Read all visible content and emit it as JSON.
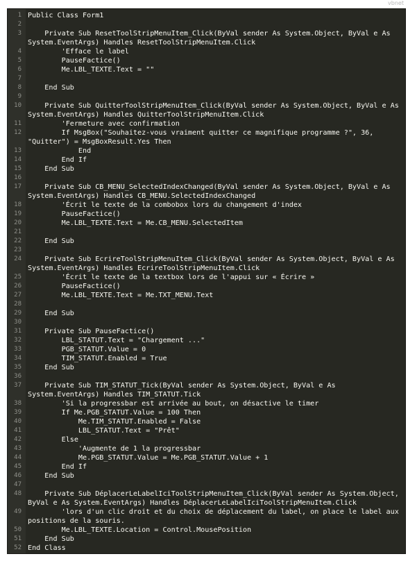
{
  "lang_label": "vbnet",
  "lines": [
    {
      "n": "1",
      "text": "Public Class Form1"
    },
    {
      "n": "2",
      "text": ""
    },
    {
      "n": "3",
      "text": "    Private Sub ResetToolStripMenuItem_Click(ByVal sender As System.Object, ByVal e As"
    },
    {
      "n": "",
      "text": "System.EventArgs) Handles ResetToolStripMenuItem.Click"
    },
    {
      "n": "4",
      "text": "        'Efface le label"
    },
    {
      "n": "5",
      "text": "        PauseFactice()"
    },
    {
      "n": "6",
      "text": "        Me.LBL_TEXTE.Text = \"\""
    },
    {
      "n": "7",
      "text": ""
    },
    {
      "n": "8",
      "text": "    End Sub"
    },
    {
      "n": "9",
      "text": ""
    },
    {
      "n": "10",
      "text": "    Private Sub QuitterToolStripMenuItem_Click(ByVal sender As System.Object, ByVal e As"
    },
    {
      "n": "",
      "text": "System.EventArgs) Handles QuitterToolStripMenuItem.Click"
    },
    {
      "n": "11",
      "text": "        'Fermeture avec confirmation"
    },
    {
      "n": "12",
      "text": "        If MsgBox(\"Souhaitez-vous vraiment quitter ce magnifique programme ?\", 36,"
    },
    {
      "n": "",
      "text": "\"Quitter\") = MsgBoxResult.Yes Then"
    },
    {
      "n": "13",
      "text": "            End"
    },
    {
      "n": "14",
      "text": "        End If"
    },
    {
      "n": "15",
      "text": "    End Sub"
    },
    {
      "n": "16",
      "text": ""
    },
    {
      "n": "17",
      "text": "    Private Sub CB_MENU_SelectedIndexChanged(ByVal sender As System.Object, ByVal e As"
    },
    {
      "n": "",
      "text": "System.EventArgs) Handles CB_MENU.SelectedIndexChanged"
    },
    {
      "n": "18",
      "text": "        'Écrit le texte de la combobox lors du changement d'index"
    },
    {
      "n": "19",
      "text": "        PauseFactice()"
    },
    {
      "n": "20",
      "text": "        Me.LBL_TEXTE.Text = Me.CB_MENU.SelectedItem"
    },
    {
      "n": "21",
      "text": ""
    },
    {
      "n": "22",
      "text": "    End Sub"
    },
    {
      "n": "23",
      "text": ""
    },
    {
      "n": "24",
      "text": "    Private Sub EcrireToolStripMenuItem_Click(ByVal sender As System.Object, ByVal e As"
    },
    {
      "n": "",
      "text": "System.EventArgs) Handles EcrireToolStripMenuItem.Click"
    },
    {
      "n": "25",
      "text": "        'Écrit le texte de la textbox lors de l'appui sur « Écrire »"
    },
    {
      "n": "26",
      "text": "        PauseFactice()"
    },
    {
      "n": "27",
      "text": "        Me.LBL_TEXTE.Text = Me.TXT_MENU.Text"
    },
    {
      "n": "28",
      "text": ""
    },
    {
      "n": "29",
      "text": "    End Sub"
    },
    {
      "n": "30",
      "text": ""
    },
    {
      "n": "31",
      "text": "    Private Sub PauseFactice()"
    },
    {
      "n": "32",
      "text": "        LBL_STATUT.Text = \"Chargement ...\""
    },
    {
      "n": "33",
      "text": "        PGB_STATUT.Value = 0"
    },
    {
      "n": "34",
      "text": "        TIM_STATUT.Enabled = True"
    },
    {
      "n": "35",
      "text": "    End Sub"
    },
    {
      "n": "36",
      "text": ""
    },
    {
      "n": "37",
      "text": "    Private Sub TIM_STATUT_Tick(ByVal sender As System.Object, ByVal e As"
    },
    {
      "n": "",
      "text": "System.EventArgs) Handles TIM_STATUT.Tick"
    },
    {
      "n": "38",
      "text": "        'Si la progressbar est arrivée au bout, on désactive le timer"
    },
    {
      "n": "39",
      "text": "        If Me.PGB_STATUT.Value = 100 Then"
    },
    {
      "n": "40",
      "text": "            Me.TIM_STATUT.Enabled = False"
    },
    {
      "n": "41",
      "text": "            LBL_STATUT.Text = \"Prêt\""
    },
    {
      "n": "42",
      "text": "        Else"
    },
    {
      "n": "43",
      "text": "            'Augmente de 1 la progressbar"
    },
    {
      "n": "44",
      "text": "            Me.PGB_STATUT.Value = Me.PGB_STATUT.Value + 1"
    },
    {
      "n": "45",
      "text": "        End If"
    },
    {
      "n": "46",
      "text": "    End Sub"
    },
    {
      "n": "47",
      "text": ""
    },
    {
      "n": "48",
      "text": "    Private Sub DéplacerLeLabelIciToolStripMenuItem_Click(ByVal sender As System.Object,"
    },
    {
      "n": "",
      "text": "ByVal e As System.EventArgs) Handles DéplacerLeLabelIciToolStripMenuItem.Click"
    },
    {
      "n": "49",
      "text": "        'lors d'un clic droit et du choix de déplacement du label, on place le label aux"
    },
    {
      "n": "",
      "text": "positions de la souris."
    },
    {
      "n": "50",
      "text": "        Me.LBL_TEXTE.Location = Control.MousePosition"
    },
    {
      "n": "51",
      "text": "    End Sub"
    },
    {
      "n": "52",
      "text": "End Class"
    }
  ]
}
